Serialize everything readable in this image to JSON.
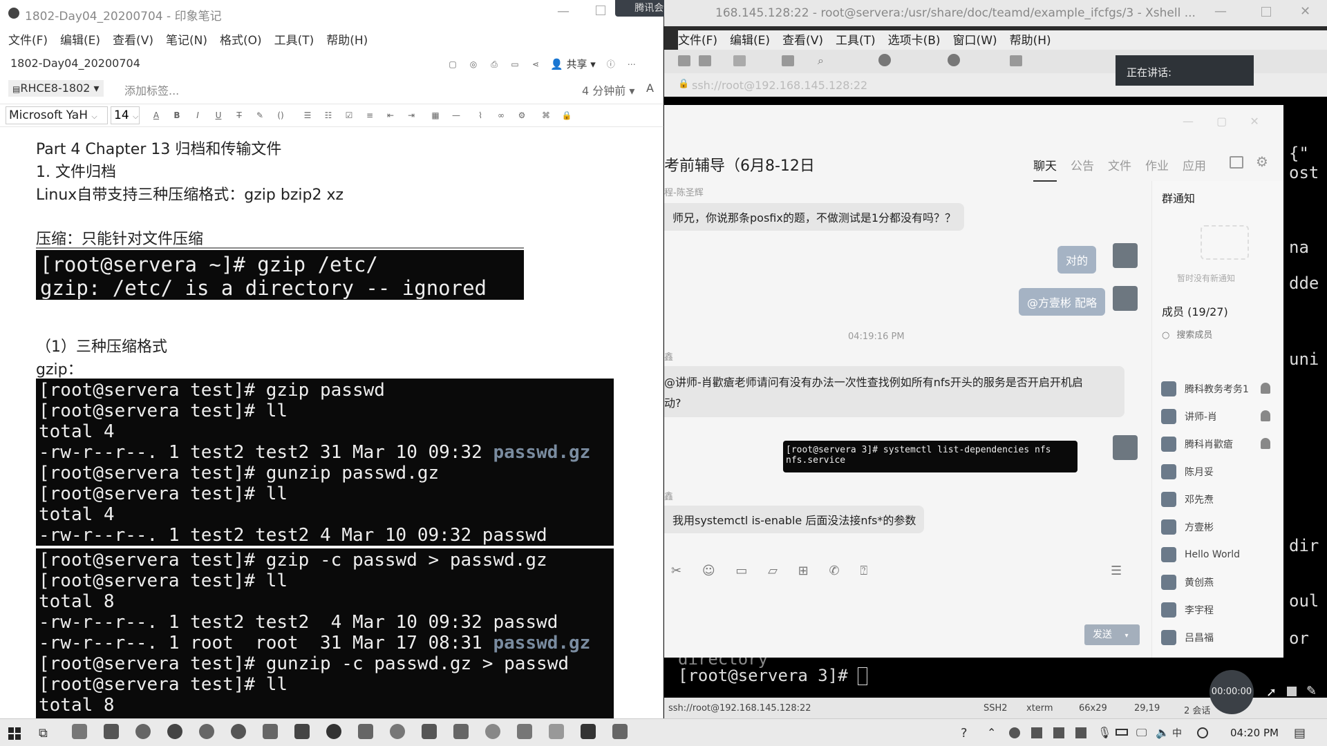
{
  "evernote": {
    "title": "1802-Day04_20200704 - 印象笔记",
    "menu": [
      "文件(F)",
      "编辑(E)",
      "查看(V)",
      "笔记(N)",
      "格式(O)",
      "工具(T)",
      "帮助(H)"
    ],
    "note_title": "1802-Day04_20200704",
    "share": "共享",
    "notebook": "RHCE8-1802",
    "add_tag": "添加标签...",
    "updated": "4 分钟前",
    "font": "Microsoft YaH",
    "font_size": "14",
    "lines": {
      "l1": "Part 4 Chapter 13 归档和传输文件",
      "l2": "1. 文件归档",
      "l3": "Linux自带支持三种压缩格式：gzip bzip2 xz",
      "l4": "压缩：只能针对文件压缩",
      "l5": "（1）三种压缩格式",
      "l6": "gzip："
    },
    "term1": [
      "[root@servera ~]# gzip /etc/",
      "gzip: /etc/ is a directory -- ignored"
    ],
    "term2": [
      "[root@servera test]# gzip passwd",
      "[root@servera test]# ll",
      "total 4",
      "-rw-r--r--. 1 test2 test2 31 Mar 10 09:32 ",
      "[root@servera test]# gunzip passwd.gz",
      "[root@servera test]# ll",
      "total 4",
      "-rw-r--r--. 1 test2 test2 4 Mar 10 09:32 passwd"
    ],
    "term2_gz": "passwd.gz",
    "term3": [
      "[root@servera test]# gzip -c passwd > passwd.gz",
      "[root@servera test]# ll",
      "total 8",
      "-rw-r--r--. 1 test2 test2  4 Mar 10 09:32 passwd",
      "-rw-r--r--. 1 root  root  31 Mar 17 08:31 ",
      "[root@servera test]# gunzip -c passwd.gz > passwd",
      "[root@servera test]# ll",
      "total 8"
    ],
    "term3_gz": "passwd.gz"
  },
  "meeting_tab": "腾讯会议",
  "xshell": {
    "title": "168.145.128:22 - root@servera:/usr/share/doc/teamd/example_ifcfgs/3 - Xshell ...",
    "menu": [
      "文件(F)",
      "编辑(E)",
      "查看(V)",
      "工具(T)",
      "选项卡(B)",
      "窗口(W)",
      "帮助(H)"
    ],
    "address": "ssh://root@192.168.145.128:22",
    "speaking": "正在讲话:",
    "right_text": [
      "{\"",
      "ost",
      "na",
      "dde",
      "uni",
      "dir",
      "oul",
      "or"
    ],
    "term_prev": "directory",
    "prompt": "[root@servera 3]# ",
    "status": {
      "addr": "ssh://root@192.168.145.128:22",
      "proto": "SSH2",
      "term": "xterm",
      "size": "66x29",
      "pos": "29,19",
      "sessions": "2 会话"
    }
  },
  "chat": {
    "group_title": "考前辅导（6月8-12日",
    "tabs": [
      "聊天",
      "公告",
      "文件",
      "作业",
      "应用"
    ],
    "sender1": "程-陈圣辉",
    "msg1": "师兄，你说那条posfix的题，不做测试是1分都没有吗？？",
    "msg2": "对的",
    "msg3": "@方壹彬 配略",
    "timestamp": "04:19:16 PM",
    "sender2": "鑫",
    "msg4_line1": "@讲师-肖歡瘡老师请问有没有办法一次性查找例如所有nfs开头的服务是否开启开机启",
    "msg4_line2": "动?",
    "msg5_line1": "[root@servera 3]# systemctl list-dependencies nfs",
    "msg5_line2": "nfs.service",
    "sender3": "鑫",
    "msg6": "我用systemctl is-enable 后面没法接nfs*的参数",
    "send": "发送",
    "notice_title": "群通知",
    "notice_empty": "暂时没有新通知",
    "members_title": "成员 (19/27)",
    "search_member": "搜索成员",
    "members": [
      "腾科教务考务1",
      "讲师-肖",
      "腾科肖歡瘡",
      "陈月妥",
      "邓先焘",
      "方壹彬",
      "Hello World",
      "黄创燕",
      "李宇程",
      "吕昌福"
    ]
  },
  "recording": "00:00:00",
  "taskbar": {
    "time": "04:20 PM"
  }
}
